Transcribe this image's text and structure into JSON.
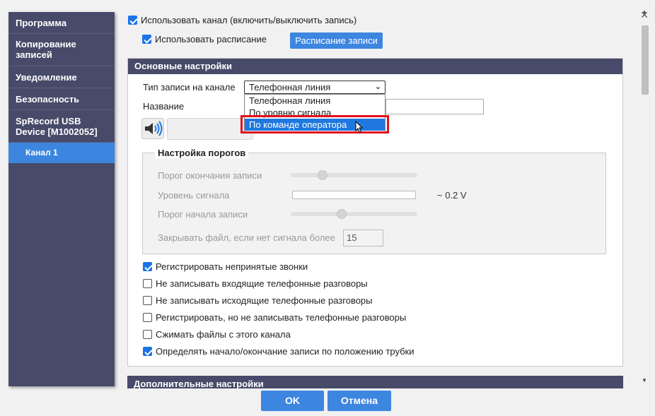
{
  "window": {
    "close_glyph": "×"
  },
  "sidebar": {
    "items": [
      {
        "label": "Программа"
      },
      {
        "label": "Копирование\nзаписей"
      },
      {
        "label": "Уведомление"
      },
      {
        "label": "Безопасность"
      },
      {
        "label": "SpRecord USB\nDevice [M1002052]"
      },
      {
        "label": "Канал 1",
        "active": true
      }
    ]
  },
  "top": {
    "use_channel_label": "Использовать канал (включить/выключить запись)",
    "use_channel_checked": true,
    "use_schedule_label": "Использовать расписание",
    "use_schedule_checked": true,
    "schedule_button": "Расписание записи"
  },
  "main": {
    "title": "Основные настройки",
    "record_type_label": "Тип записи на канале",
    "record_type_value": "Телефонная линия",
    "record_type_options": [
      "Телефонная линия",
      "По уровню сигнала",
      "По команде оператора"
    ],
    "highlighted_option_index": 2,
    "name_label": "Название",
    "name_value": "",
    "thresholds": {
      "legend": "Настройка порогов",
      "end_threshold_label": "Порог окончания записи",
      "end_threshold_level": 0.25,
      "signal_level_label": "Уровень сигнала",
      "signal_level_value": "~ 0.2 V",
      "start_threshold_label": "Порог начала записи",
      "start_threshold_level": 0.4,
      "close_file_label": "Закрывать файл, если нет сигнала более",
      "close_file_value": "15"
    },
    "options": [
      {
        "label": "Регистрировать непринятые звонки",
        "checked": true
      },
      {
        "label": "Не записывать входящие телефонные разговоры",
        "checked": false
      },
      {
        "label": "Не записывать исходящие телефонные разговоры",
        "checked": false
      },
      {
        "label": "Регистрировать, но не записывать телефонные разговоры",
        "checked": false
      },
      {
        "label": "Сжимать файлы с этого канала",
        "checked": false
      },
      {
        "label": "Определять начало/окончание записи по положению трубки",
        "checked": true
      }
    ]
  },
  "extra": {
    "title": "Дополнительные настройки"
  },
  "footer": {
    "ok_label": "OK",
    "cancel_label": "Отмена"
  },
  "colors": {
    "accent": "#3d86e0",
    "sidebar_bg": "#474a68",
    "highlight_border": "#e0101a"
  }
}
